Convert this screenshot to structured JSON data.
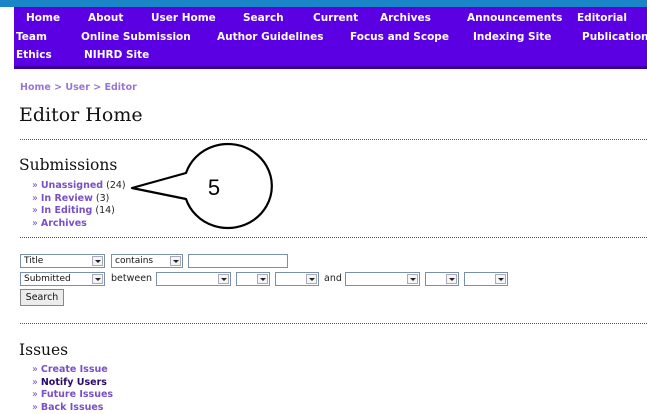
{
  "nav": {
    "row1": [
      "Home",
      "About",
      "User Home",
      "Search",
      "Current",
      "Archives",
      "Announcements",
      "Editorial"
    ],
    "row2": [
      "Team",
      "Online Submission",
      "Author Guidelines",
      "Focus and Scope",
      "Indexing Site",
      "Publication"
    ],
    "row3": [
      "Ethics",
      "NIHRD Site"
    ]
  },
  "breadcrumb": {
    "home": "Home",
    "sep": ">",
    "user": "User",
    "editor": "Editor"
  },
  "page_title": "Editor Home",
  "submissions": {
    "heading": "Submissions",
    "items": [
      {
        "bullet": "»",
        "label": "Unassigned",
        "count": "(24)"
      },
      {
        "bullet": "»",
        "label": "In Review",
        "count": "(3)"
      },
      {
        "bullet": "»",
        "label": "In Editing",
        "count": "(14)"
      },
      {
        "bullet": "»",
        "label": "Archives",
        "count": ""
      }
    ]
  },
  "callout": {
    "number": "5"
  },
  "search_form": {
    "field_select": "Title",
    "match_select": "contains",
    "date_select": "Submitted",
    "between_label": "between",
    "and_label": "and",
    "search_button": "Search"
  },
  "issues": {
    "heading": "Issues",
    "items": [
      {
        "bullet": "»",
        "label": "Create Issue"
      },
      {
        "bullet": "»",
        "label": "Notify Users"
      },
      {
        "bullet": "»",
        "label": "Future Issues"
      },
      {
        "bullet": "»",
        "label": "Back Issues"
      }
    ]
  }
}
